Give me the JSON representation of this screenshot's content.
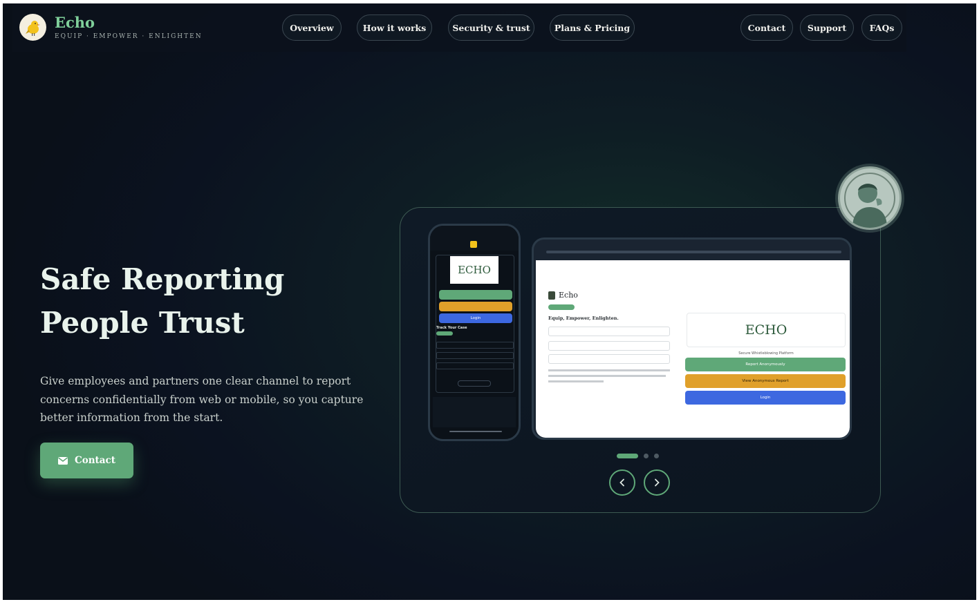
{
  "brand": {
    "name": "Echo",
    "tagline": "EQUIP · EMPOWER · ENLIGHTEN"
  },
  "nav": {
    "center": [
      "Overview",
      "How it works",
      "Security & trust",
      "Plans & Pricing"
    ],
    "right": [
      "Contact",
      "Support",
      "FAQs"
    ]
  },
  "hero": {
    "title": "Safe Reporting People Trust",
    "subtitle": "Give employees and partners one clear channel to report concerns confidentially from web or mobile, so you capture better information from the start.",
    "cta_label": "Contact"
  },
  "mock_tablet": {
    "brand": "Echo",
    "heading": "Equip, Empower, Enlighten.",
    "logo_text": "ECHO",
    "platform_label": "Secure Whistleblowing Platform",
    "btn_report": "Report Anonymously",
    "btn_view": "View Anonymous Report",
    "btn_login": "Login"
  },
  "mock_phone": {
    "logo_text": "ECHO",
    "track_label": "Track Your Case",
    "btn_login": "Login"
  },
  "colors": {
    "accent": "#5fa878",
    "orange": "#e0a02a",
    "blue": "#3d68e0",
    "brand_green": "#7fcf9a"
  },
  "carousel": {
    "active_slide": 1,
    "slide_count": 3
  }
}
